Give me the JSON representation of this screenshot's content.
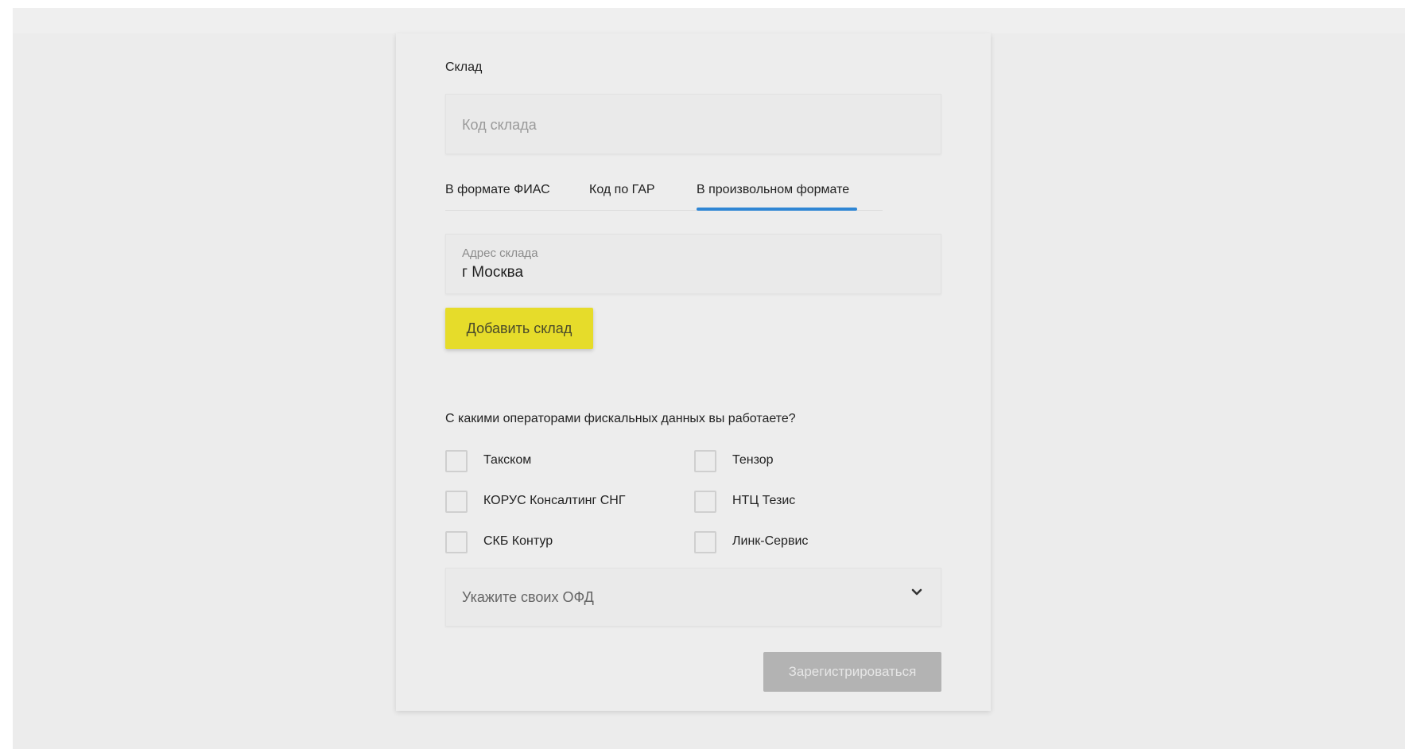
{
  "warehouse": {
    "section_label": "Склад",
    "code_placeholder": "Код склада",
    "tabs": [
      {
        "label": "В формате ФИАС",
        "active": false
      },
      {
        "label": "Код по ГАР",
        "active": false
      },
      {
        "label": "В произвольном формате",
        "active": true
      }
    ],
    "address_label": "Адрес склада",
    "address_value": "г Москва",
    "add_button": "Добавить склад"
  },
  "ofd": {
    "question": "С какими операторами фискальных данных вы работаете?",
    "operators": [
      {
        "label": "Такском",
        "checked": false
      },
      {
        "label": "Тензор",
        "checked": false
      },
      {
        "label": "КОРУС Консалтинг СНГ",
        "checked": false
      },
      {
        "label": "НТЦ Тезис",
        "checked": false
      },
      {
        "label": "СКБ Контур",
        "checked": false
      },
      {
        "label": "Линк-Сервис",
        "checked": false
      }
    ],
    "select_placeholder": "Укажите своих ОФД",
    "select_icon": "chevron-down-icon"
  },
  "register_button": "Зарегистрироваться",
  "colors": {
    "accent_button": "#e6dc2a",
    "tab_underline": "#2f86d4",
    "disabled_button": "#b3b3b3"
  }
}
